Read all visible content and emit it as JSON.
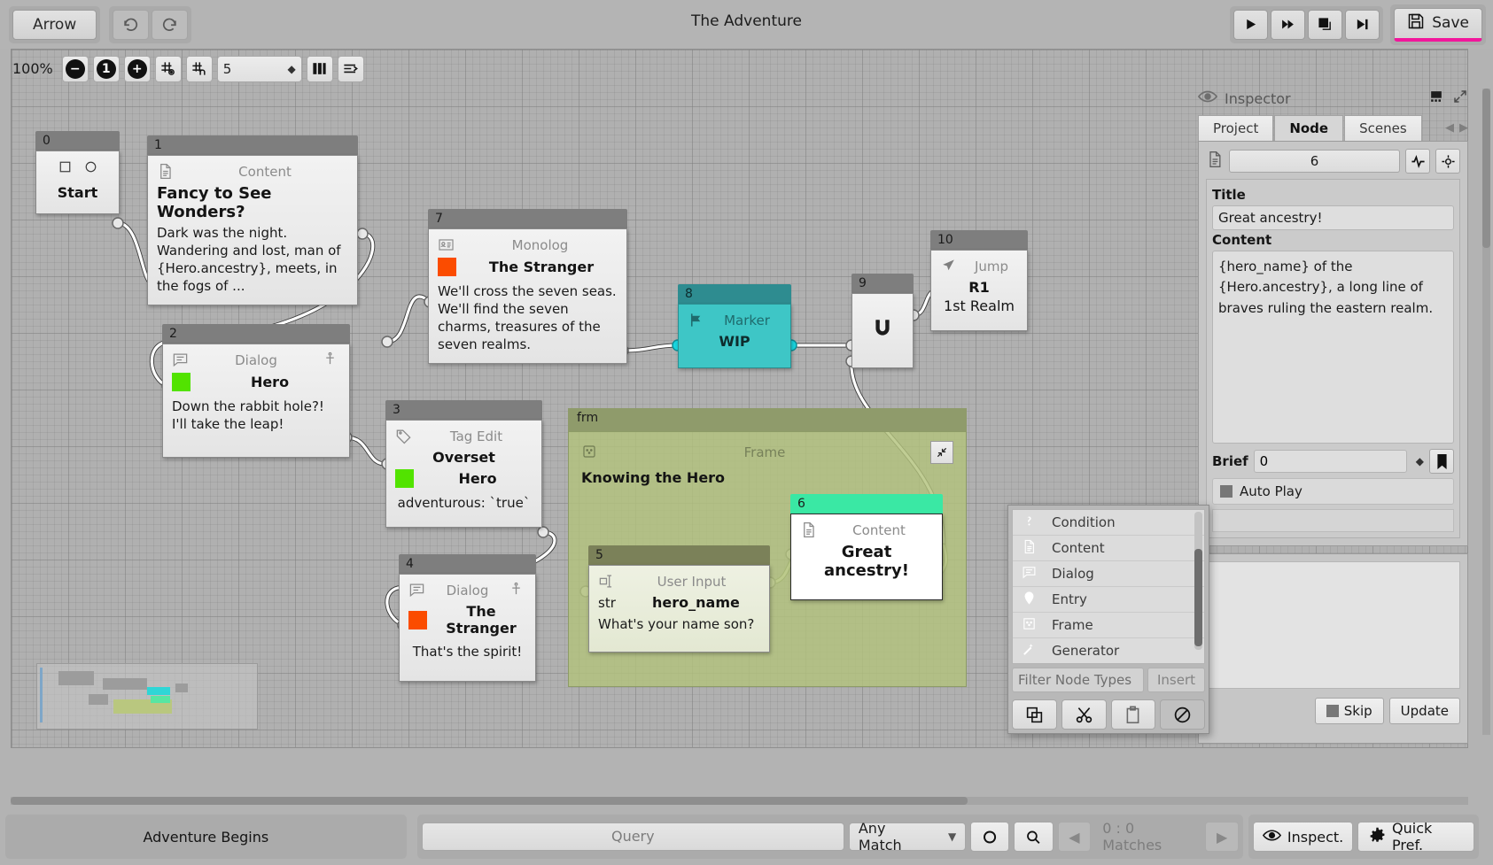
{
  "window": {
    "title": "The Adventure"
  },
  "toolbar": {
    "mode_label": "Arrow",
    "undo_icon": "undo-icon",
    "redo_icon": "redo-icon",
    "play_icon": "play-icon",
    "fast_forward_icon": "fast-forward-icon",
    "step_over_icon": "step-over-icon",
    "skip_end_icon": "skip-to-end-icon",
    "save_label": "Save",
    "save_icon": "floppy-disk-icon",
    "save_accent_color": "#f2169b"
  },
  "zoombar": {
    "zoom_level": "100%",
    "zoom_out_icon": "zoom-out-icon",
    "zoom_reset_icon": "zoom-reset-icon",
    "zoom_in_icon": "zoom-in-icon",
    "grid_snap_icon": "grid-snap-icon",
    "grid_magnet_icon": "grid-magnet-icon",
    "grid_value": "5",
    "columns_icon": "columns-icon",
    "align_icon": "align-icon"
  },
  "graph": {
    "frame": {
      "tag": "frm",
      "type": "Frame",
      "title": "Knowing the Hero",
      "collapse_icon": "collapse-icon",
      "frame_icon": "frame-icon"
    },
    "nodes": [
      {
        "id": "0",
        "type": "Start",
        "title": "Start",
        "icons": [
          "square-icon",
          "circle-icon"
        ]
      },
      {
        "id": "1",
        "type": "Content",
        "icon": "content-icon",
        "title": "Fancy to See Wonders?",
        "text": "Dark was the night. Wandering and lost, man of {Hero.ancestry}, meets, in the fogs of ..."
      },
      {
        "id": "2",
        "type": "Dialog",
        "icon": "dialog-icon",
        "accessory_icon": "person-icon",
        "speaker": "Hero",
        "speaker_color": "#52e300",
        "text": "Down the rabbit hole?! I'll take the leap!"
      },
      {
        "id": "3",
        "type": "Tag Edit",
        "icon": "tag-icon",
        "operation": "Overset",
        "speaker": "Hero",
        "speaker_color": "#52e300",
        "text": "adventurous: `true`"
      },
      {
        "id": "4",
        "type": "Dialog",
        "icon": "dialog-icon",
        "accessory_icon": "person-icon",
        "speaker": "The Stranger",
        "speaker_color": "#fb4c00",
        "text": "That's the spirit!"
      },
      {
        "id": "5",
        "type": "User Input",
        "icon": "user-input-icon",
        "var_type": "str",
        "var_name": "hero_name",
        "text": "What's your name son?"
      },
      {
        "id": "6",
        "type": "Content",
        "icon": "content-icon",
        "title": "Great ancestry!",
        "selected": true,
        "header_color": "#3ae8a4"
      },
      {
        "id": "7",
        "type": "Monolog",
        "icon": "monolog-icon",
        "speaker": "The Stranger",
        "speaker_color": "#fb4c00",
        "text": "We'll cross the seven seas. We'll find the seven charms, treasures of the seven realms."
      },
      {
        "id": "8",
        "type": "Marker",
        "icon": "flag-icon",
        "title": "WIP",
        "header_color": "#2e8c90",
        "body_color": "#3ec6c6"
      },
      {
        "id": "9",
        "type": "Magnet",
        "icon": "magnet-icon"
      },
      {
        "id": "10",
        "type": "Jump",
        "icon": "jump-icon",
        "target": "R1",
        "subtitle": "1st Realm"
      }
    ]
  },
  "inspector": {
    "panel_title": "Inspector",
    "eye_icon": "eye-icon",
    "pin_icon": "pin-icon",
    "expand_icon": "expand-icon",
    "tabs": [
      {
        "label": "Project",
        "active": false
      },
      {
        "label": "Node",
        "active": true
      },
      {
        "label": "Scenes",
        "active": false
      }
    ],
    "nav_prev_icon": "chevron-left-icon",
    "nav_next_icon": "chevron-right-icon",
    "node_id": "6",
    "node_icon": "content-icon",
    "pulse_icon": "pulse-icon",
    "target_icon": "target-icon",
    "fields": {
      "title_label": "Title",
      "title_value": "Great ancestry!",
      "content_label": "Content",
      "content_value": "{hero_name} of the {Hero.ancestry}, a long line of braves ruling the eastern realm.",
      "brief_label": "Brief",
      "brief_value": "0",
      "bookmark_icon": "bookmark-icon",
      "auto_play_label": "Auto Play",
      "auto_play_checked": true
    },
    "footer": {
      "skip_label": "Skip",
      "update_label": "Update"
    }
  },
  "node_popup": {
    "items": [
      {
        "label": "Condition",
        "icon": "question-icon"
      },
      {
        "label": "Content",
        "icon": "content-icon"
      },
      {
        "label": "Dialog",
        "icon": "dialog-icon"
      },
      {
        "label": "Entry",
        "icon": "pin-marker-icon"
      },
      {
        "label": "Frame",
        "icon": "frame-icon"
      },
      {
        "label": "Generator",
        "icon": "wand-icon"
      }
    ],
    "filter_placeholder": "Filter Node Types",
    "insert_label": "Insert",
    "copy_icon": "copy-icon",
    "cut_icon": "scissors-icon",
    "paste_icon": "clipboard-icon",
    "block_icon": "no-entry-icon"
  },
  "statusbar": {
    "scene_label": "Adventure Begins",
    "query_placeholder": "Query",
    "match_mode": "Any Match",
    "match_mode_caret": "chevron-down-icon",
    "circle_icon": "circle-outline-icon",
    "search_icon": "search-icon",
    "prev_icon": "chevron-left-icon",
    "matches_label": "0 : 0 Matches",
    "next_icon": "chevron-right-icon",
    "inspect_label": "Inspect.",
    "inspect_icon": "eye-icon",
    "quick_pref_label": "Quick Pref.",
    "quick_pref_icon": "gear-icon"
  }
}
